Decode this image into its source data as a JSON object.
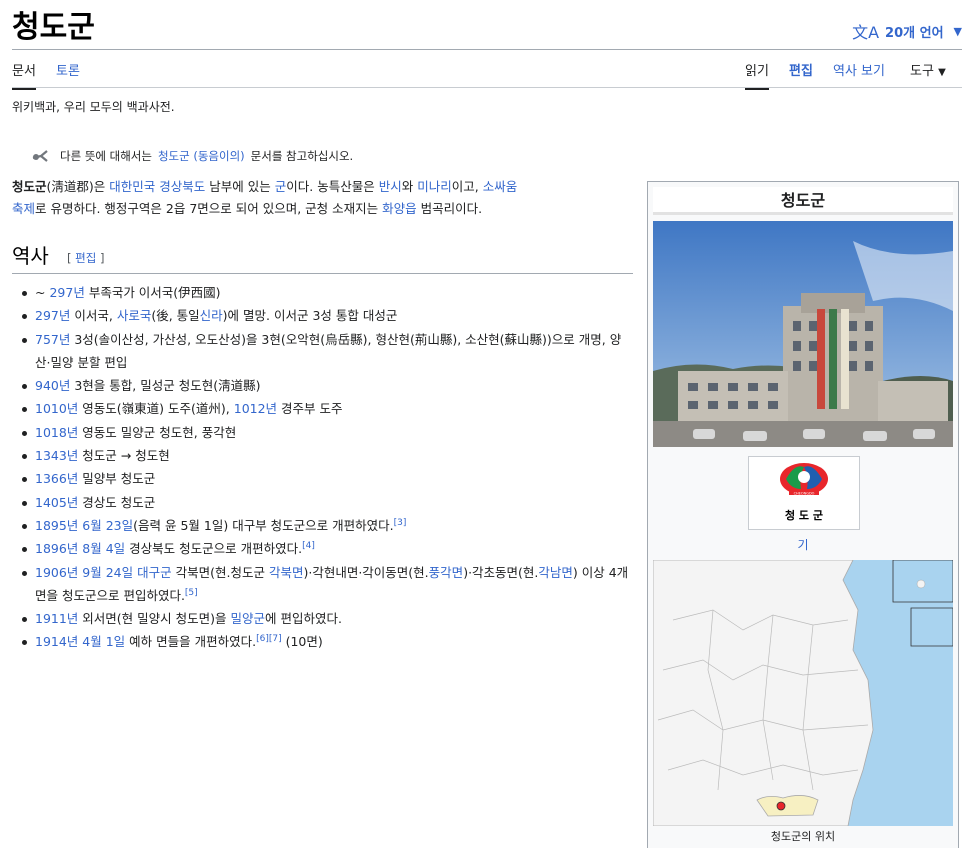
{
  "page": {
    "title": "청도군",
    "language_button": "20개 언어",
    "tagline": "위키백과, 우리 모두의 백과사전."
  },
  "tabs": {
    "article": "문서",
    "talk": "토론",
    "read": "읽기",
    "edit": "편집",
    "history": "역사 보기",
    "tools": "도구"
  },
  "hatnote": {
    "before": "다른 뜻에 대해서는",
    "link": "청도군 (동음이의)",
    "after": "문서를 참고하십시오."
  },
  "lead": {
    "t1": "청도군",
    "t2": "(淸道郡)은",
    "l1": "대한민국",
    "l2": "경상북도",
    "t3": "남부에 있는",
    "l3": "군",
    "t4": "이다. 농특산물은",
    "l4": "반시",
    "t5": "와",
    "l5": "미나리",
    "t6": "이고,",
    "l6a": "소싸움",
    "l6b": "축제",
    "t7": "로 유명하다. 행정구역은 2읍 7면으로 되어 있으며, 군청 소재지는",
    "l7": "화양읍",
    "t8": "범곡리이다."
  },
  "section": {
    "heading": "역사",
    "edit_open": "[",
    "edit_label": "편집",
    "edit_close": "]"
  },
  "history": {
    "i1": {
      "a": "~",
      "l1": "297년",
      "b": "부족국가 이서국(伊西國)"
    },
    "i2": {
      "l1": "297년",
      "a": "이서국,",
      "l2": "사로국",
      "b": "(後, 통일",
      "l3": "신라",
      "c": ")에 멸망. 이서군 3성 통합 대성군"
    },
    "i3": {
      "l1": "757년",
      "a": "3성(솔이산성, 가산성, 오도산성)을 3현(오악현(烏岳縣), 형산현(荊山縣), 소산현(蘇山縣))으로 개명, 양산·밀양 분할 편입"
    },
    "i4": {
      "l1": "940년",
      "a": "3현을 통합, 밀성군 청도현(淸道縣)"
    },
    "i5": {
      "l1": "1010년",
      "a": "영동도(嶺東道) 도주(道州),",
      "l2": "1012년",
      "b": "경주부 도주"
    },
    "i6": {
      "l1": "1018년",
      "a": "영동도 밀양군 청도현, 풍각현"
    },
    "i7": {
      "l1": "1343년",
      "a": "청도군 → 청도현"
    },
    "i8": {
      "l1": "1366년",
      "a": "밀양부 청도군"
    },
    "i9": {
      "l1": "1405년",
      "a": "경상도 청도군"
    },
    "i10": {
      "l1": "1895년",
      "l2": "6월 23일",
      "a": "(음력 윤 5월 1일) 대구부 청도군으로 개편하였다.",
      "ref": "[3]"
    },
    "i11": {
      "l1": "1896년",
      "l2": "8월 4일",
      "a": "경상북도 청도군으로 개편하였다.",
      "ref": "[4]"
    },
    "i12": {
      "l1": "1906년",
      "l2": "9월 24일",
      "l3": "대구군",
      "a": "각북면(현.청도군",
      "l4": "각북면",
      "b": ")·각현내면·각이동면(현.",
      "l5": "풍각면",
      "c": ")·각초동면(현.",
      "l6": "각남면",
      "d": ") 이상 4개 면을 청도군으로 편입하였다.",
      "ref": "[5]"
    },
    "i13": {
      "l1": "1911년",
      "a": "외서면(현 밀양시 청도면)을",
      "l2": "밀양군",
      "b": "에 편입하였다."
    },
    "i14": {
      "l1": "1914년",
      "l2": "4월 1일",
      "a": "예하 면들을 개편하였다.",
      "ref1": "[6]",
      "ref2": "[7]",
      "b": "(10면)"
    }
  },
  "infobox": {
    "title": "청도군",
    "emblem_text": "청 도 군",
    "emblem_small": "CHEONGDO",
    "flag_caption": "기",
    "map_caption": "청도군의 위치"
  },
  "colors": {
    "link": "#3366cc",
    "text": "#202122",
    "emblem_red": "#e8262b",
    "emblem_green": "#1a9b4a",
    "emblem_blue": "#1f5fb0"
  },
  "icons": {
    "language": "translate-icon",
    "dropdown": "chevron-down-icon",
    "hatnote": "disambiguation-icon"
  }
}
